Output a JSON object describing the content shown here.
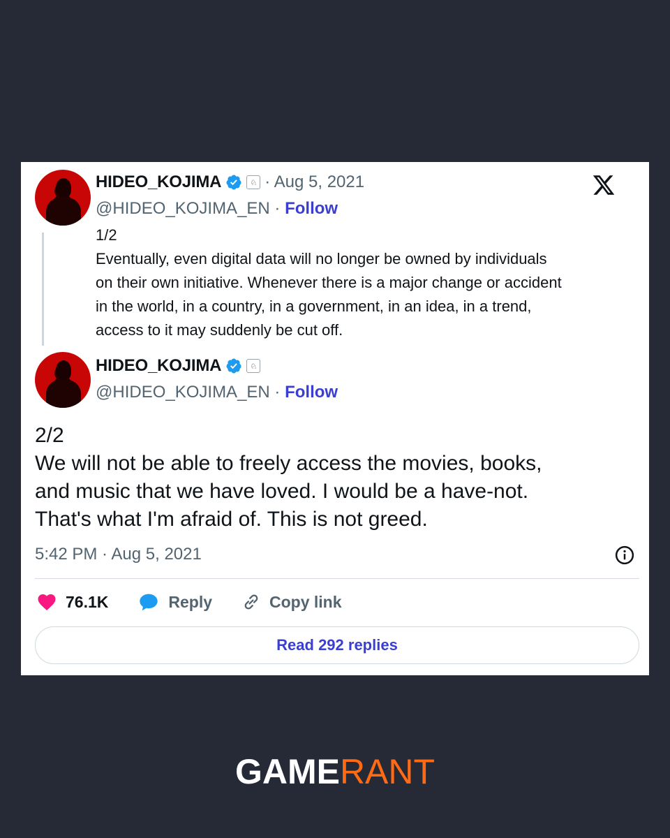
{
  "colors": {
    "background": "#262936",
    "card": "#ffffff",
    "link": "#3b3fd1",
    "verified": "#1d9bf0",
    "like": "#f91880",
    "brand_orange": "#ff6a13"
  },
  "tweet1": {
    "display_name": "HIDEO_KOJIMA",
    "date_sep": " · Aug 5, 2021",
    "handle": "@HIDEO_KOJIMA_EN · ",
    "follow_label": "Follow",
    "text": "1/2\nEventually, even digital data will no longer be owned by individuals\non their own initiative. Whenever there is a major change or accident\nin the world, in a country, in a government, in an idea, in a trend,\naccess to it may suddenly be cut off."
  },
  "tweet2": {
    "display_name": "HIDEO_KOJIMA",
    "handle": "@HIDEO_KOJIMA_EN · ",
    "follow_label": "Follow",
    "text": "2/2\nWe will not be able to freely access the movies, books,\nand music that we have loved. I would be a have-not.\nThat's what I'm afraid of. This is not greed.",
    "timestamp": "5:42 PM · Aug 5, 2021"
  },
  "actions": {
    "likes": "76.1K",
    "reply_label": "Reply",
    "copy_link_label": "Copy link",
    "read_replies_label": "Read 292 replies"
  },
  "icons": [
    "x-logo-icon",
    "verified-badge-icon",
    "affiliate-badge-icon",
    "heart-icon",
    "reply-bubble-icon",
    "link-icon",
    "info-icon"
  ],
  "footer": {
    "brand_part1": "GAME",
    "brand_part2": "RANT"
  }
}
